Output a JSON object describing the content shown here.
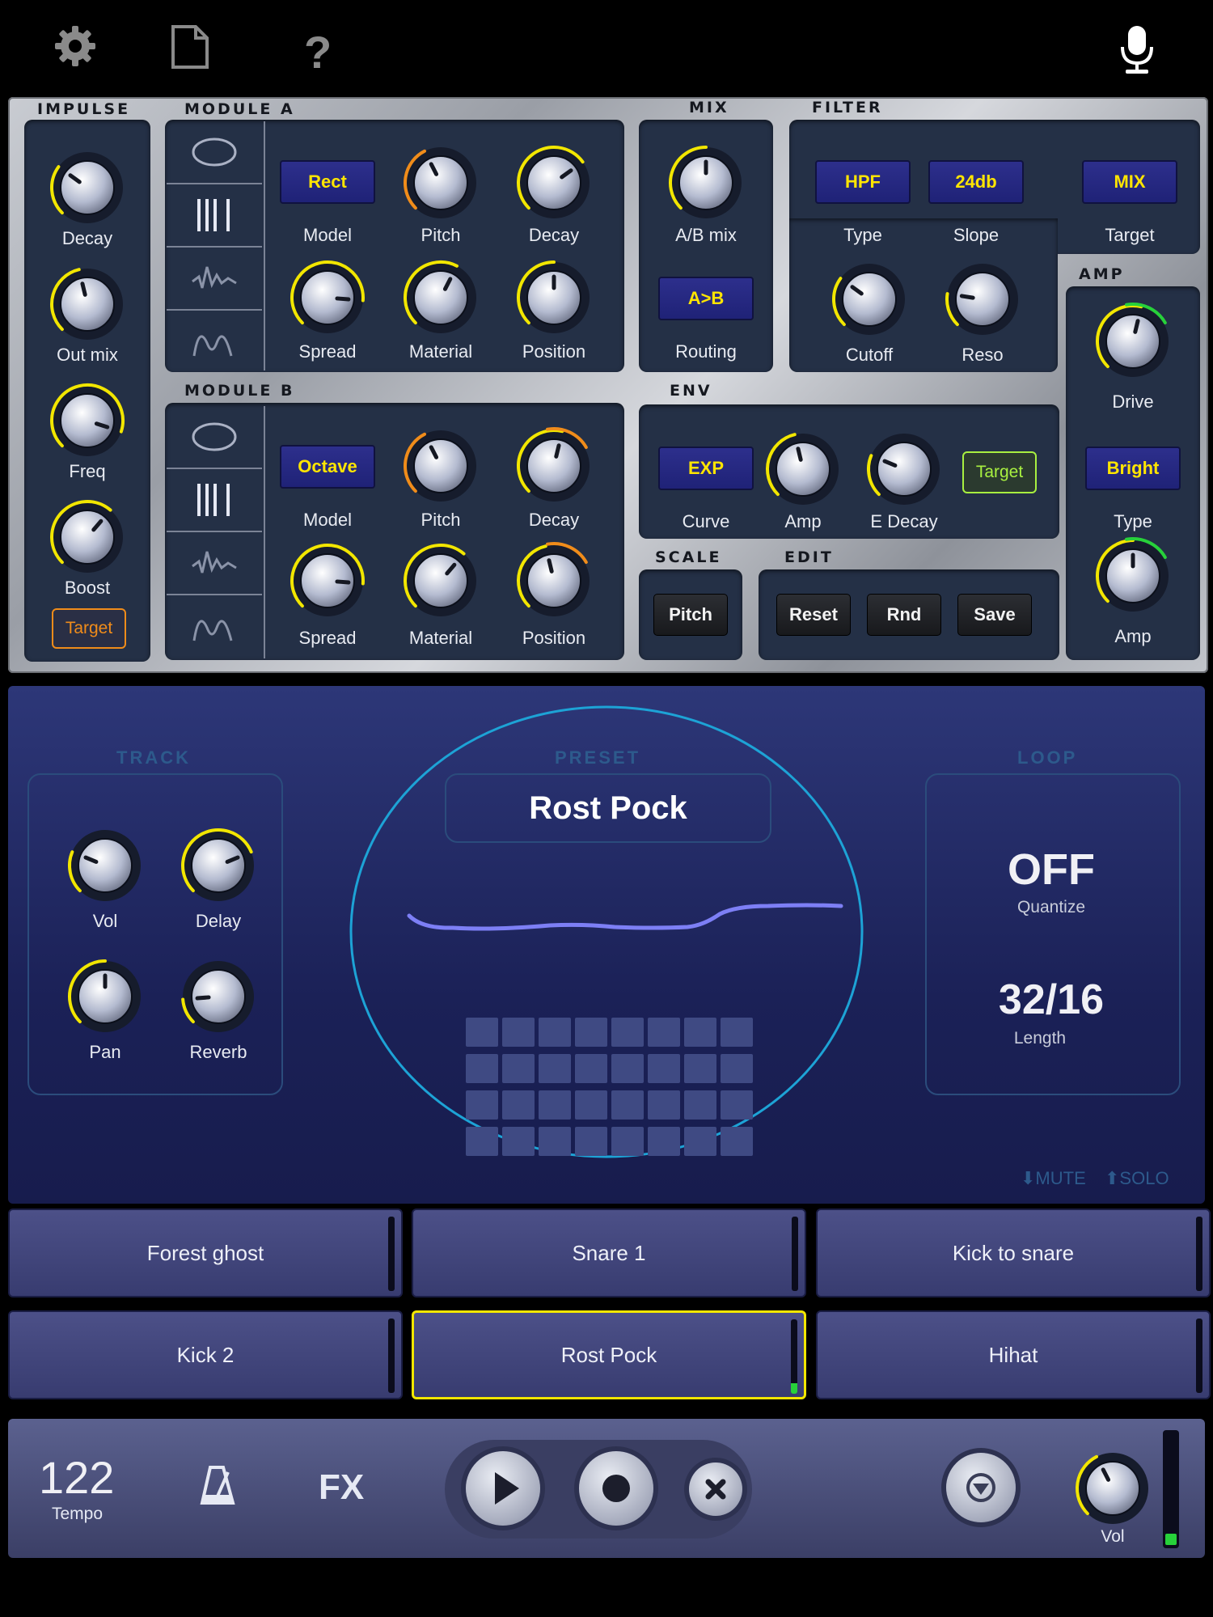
{
  "topbar": {
    "icons": [
      "gear-icon",
      "document-icon",
      "help-icon",
      "microphone-icon"
    ],
    "help_glyph": "?"
  },
  "impulse": {
    "title": "IMPULSE",
    "knobs": [
      {
        "label": "Decay",
        "value": 0.3
      },
      {
        "label": "Out mix",
        "value": 0.45
      },
      {
        "label": "Freq",
        "value": 0.9
      },
      {
        "label": "Boost",
        "value": 0.65
      }
    ],
    "target_label": "Target"
  },
  "module_a": {
    "title": "MODULE A",
    "model_label": "Model",
    "model_value": "Rect",
    "knobs": [
      {
        "label": "Pitch",
        "value": 0.4
      },
      {
        "label": "Decay",
        "value": 0.7
      },
      {
        "label": "Spread",
        "value": 0.85
      },
      {
        "label": "Material",
        "value": 0.6
      },
      {
        "label": "Position",
        "value": 0.5
      }
    ]
  },
  "module_b": {
    "title": "MODULE B",
    "model_label": "Model",
    "model_value": "Octave",
    "knobs": [
      {
        "label": "Pitch",
        "value": 0.4
      },
      {
        "label": "Decay",
        "value": 0.55
      },
      {
        "label": "Spread",
        "value": 0.85
      },
      {
        "label": "Material",
        "value": 0.65
      },
      {
        "label": "Position",
        "value": 0.45
      }
    ]
  },
  "mix": {
    "title": "MIX",
    "knob": {
      "label": "A/B mix",
      "value": 0.5
    },
    "routing_label": "Routing",
    "routing_value": "A>B"
  },
  "filter": {
    "title": "FILTER",
    "type_label": "Type",
    "type_value": "HPF",
    "slope_label": "Slope",
    "slope_value": "24db",
    "target_label": "Target",
    "target_value": "MIX",
    "knobs": [
      {
        "label": "Cutoff",
        "value": 0.3
      },
      {
        "label": "Reso",
        "value": 0.2
      }
    ]
  },
  "amp": {
    "title": "AMP",
    "drive": {
      "label": "Drive",
      "value": 0.55
    },
    "type_label": "Type",
    "type_value": "Bright",
    "amp": {
      "label": "Amp",
      "value": 0.5
    }
  },
  "env": {
    "title": "ENV",
    "curve_label": "Curve",
    "curve_value": "EXP",
    "knobs": [
      {
        "label": "Amp",
        "value": 0.45
      },
      {
        "label": "E Decay",
        "value": 0.25
      }
    ],
    "target_label": "Target"
  },
  "scale": {
    "title": "SCALE",
    "pitch_label": "Pitch"
  },
  "edit": {
    "title": "EDIT",
    "reset_label": "Reset",
    "rnd_label": "Rnd",
    "save_label": "Save"
  },
  "track": {
    "title": "TRACK",
    "knobs": [
      {
        "label": "Vol",
        "value": 0.25
      },
      {
        "label": "Delay",
        "value": 0.75
      },
      {
        "label": "Pan",
        "value": 0.5
      },
      {
        "label": "Reverb",
        "value": 0.15
      }
    ]
  },
  "preset": {
    "title": "PRESET",
    "name": "Rost Pock"
  },
  "loop": {
    "title": "LOOP",
    "quantize_value": "OFF",
    "quantize_label": "Quantize",
    "length_value": "32/16",
    "length_label": "Length"
  },
  "mute_solo": {
    "mute": "⬇MUTE",
    "solo": "⬆SOLO"
  },
  "tracks": [
    "Forest ghost",
    "Snare 1",
    "Kick to snare",
    "Kick 2",
    "Rost Pock",
    "Hihat"
  ],
  "selected_track": 4,
  "transport": {
    "tempo_value": "122",
    "tempo_label": "Tempo",
    "fx_label": "FX",
    "vol_label": "Vol",
    "vol_value": 0.4,
    "meter_level": 0.1
  },
  "colors": {
    "accent_yellow": "#f2e600",
    "accent_orange": "#f08c1a",
    "accent_green": "#27d13a",
    "env_target_green": "#a8f040"
  }
}
